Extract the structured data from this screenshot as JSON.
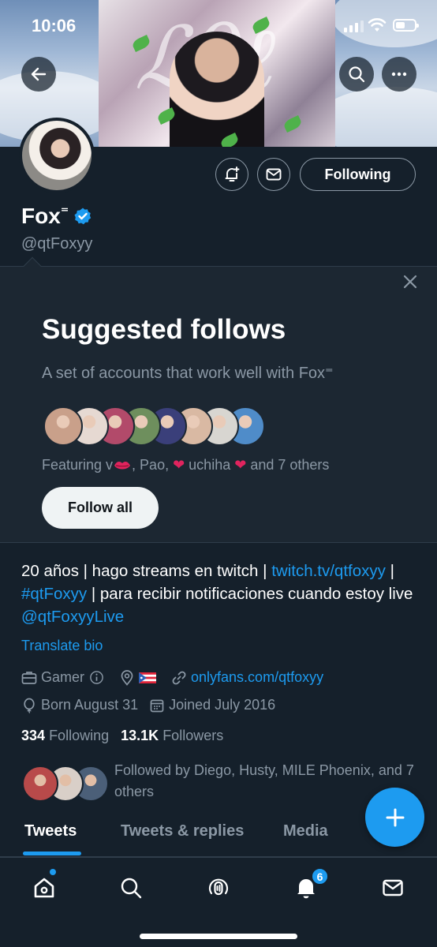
{
  "status_bar": {
    "time": "10:06"
  },
  "profile": {
    "name": "Fox",
    "name_suffix": "⁼",
    "handle": "@qtFoxyy",
    "following_label": "Following"
  },
  "suggested": {
    "title": "Suggested follows",
    "subtitle": "A set of accounts that work well with Fox⁼",
    "featuring_prefix": "Featuring v",
    "featuring_mid1": ", Pao, ",
    "featuring_mid2": " uchiha ",
    "featuring_suffix": " and 7 others",
    "follow_all_label": "Follow all",
    "face_colors": [
      "#c9a08a",
      "#e6d9d2",
      "#b24a6a",
      "#6e8f5d",
      "#3a3f7a",
      "#d9b9a3",
      "#d8d6d1",
      "#4f8cc9"
    ]
  },
  "bio": {
    "part1": "20 años | hago streams en twitch | ",
    "link1": "twitch.tv/qtfoxyy",
    "part2": " | ",
    "hashtag": "#qtFoxyy",
    "part3": " | para recibir notificaciones cuando estoy live ",
    "mention": "@qtFoxyyLive",
    "translate_label": "Translate bio"
  },
  "meta": {
    "category": "Gamer",
    "location_flag": "🇵🇷",
    "website": "onlyfans.com/qtfoxyy",
    "born": "Born August 31",
    "joined": "Joined July 2016"
  },
  "counts": {
    "following_count": "334",
    "following_label": "Following",
    "followers_count": "13.1K",
    "followers_label": "Followers"
  },
  "followed_by": {
    "text": "Followed by Diego, Husty, MILE Phoenix, and 7 others",
    "face_colors": [
      "#b84a4a",
      "#d9cfc8",
      "#4b5f78"
    ]
  },
  "tabs": [
    "Tweets",
    "Tweets & replies",
    "Media"
  ],
  "nav": {
    "notifications_badge": "6"
  },
  "colors": {
    "accent": "#1d9bf0",
    "background": "#15202b",
    "card": "#1c2732",
    "muted": "#8b98a5"
  }
}
